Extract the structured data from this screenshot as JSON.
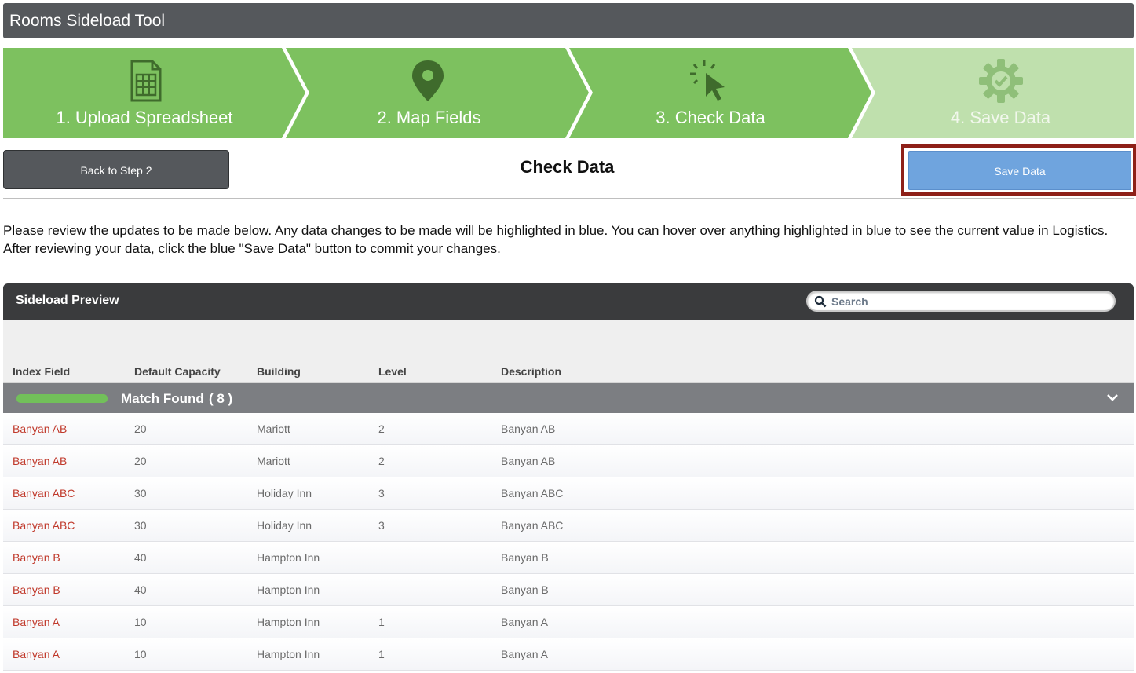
{
  "app": {
    "title": "Rooms Sideload Tool"
  },
  "steps": [
    {
      "label": "1. Upload Spreadsheet",
      "icon": "spreadsheet-icon"
    },
    {
      "label": "2. Map Fields",
      "icon": "map-pin-icon"
    },
    {
      "label": "3. Check Data",
      "icon": "cursor-click-icon"
    },
    {
      "label": "4. Save Data",
      "icon": "gear-check-icon"
    }
  ],
  "toolbar": {
    "back_label": "Back to Step 2",
    "page_title": "Check Data",
    "save_label": "Save Data"
  },
  "instructions": "Please review the updates to be made below. Any data changes to be made will be highlighted in blue. You can hover over anything highlighted in blue to see the current value in Logistics. After reviewing your data, click the blue \"Save Data\" button to commit your changes.",
  "grid": {
    "title": "Sideload Preview",
    "search_placeholder": "Search",
    "columns": [
      "Index Field",
      "Default Capacity",
      "Building",
      "Level",
      "Description"
    ],
    "group": {
      "label": "Match Found",
      "count": "( 8 )"
    },
    "rows": [
      [
        "Banyan AB",
        "20",
        "Mariott",
        "2",
        "Banyan AB"
      ],
      [
        "Banyan AB",
        "20",
        "Mariott",
        "2",
        "Banyan AB"
      ],
      [
        "Banyan ABC",
        "30",
        "Holiday Inn",
        "3",
        "Banyan ABC"
      ],
      [
        "Banyan ABC",
        "30",
        "Holiday Inn",
        "3",
        "Banyan ABC"
      ],
      [
        "Banyan B",
        "40",
        "Hampton Inn",
        "",
        "Banyan B"
      ],
      [
        "Banyan B",
        "40",
        "Hampton Inn",
        "",
        "Banyan B"
      ],
      [
        "Banyan A",
        "10",
        "Hampton Inn",
        "1",
        "Banyan A"
      ],
      [
        "Banyan A",
        "10",
        "Hampton Inn",
        "1",
        "Banyan A"
      ]
    ]
  },
  "colors": {
    "step_active": "#7dc15f",
    "step_inactive": "#bfe0ad",
    "titlebar": "#55585c",
    "save_button": "#6fa4de",
    "highlight_border": "#8e2018",
    "index_text": "#c0392b"
  }
}
